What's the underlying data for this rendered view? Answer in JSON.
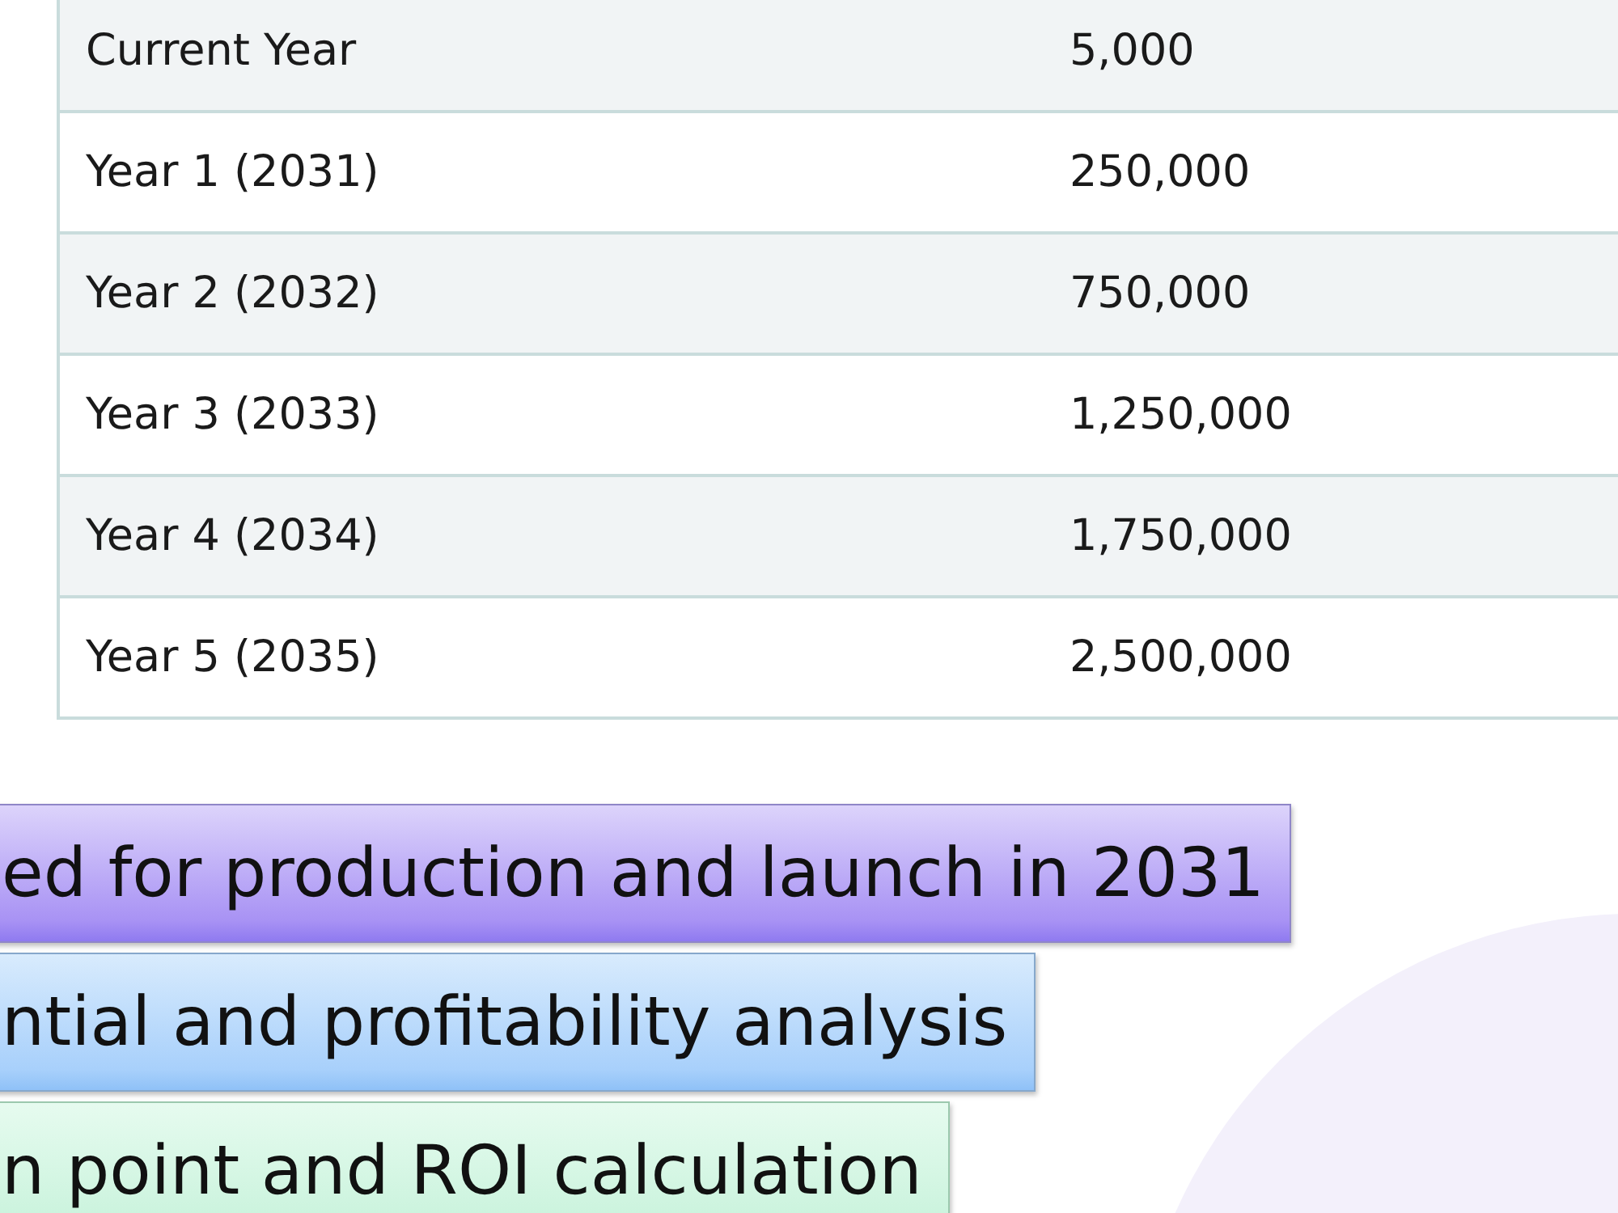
{
  "table": {
    "rows": [
      {
        "label": "Current Year",
        "value": "5,000"
      },
      {
        "label": "Year 1 (2031)",
        "value": "250,000"
      },
      {
        "label": "Year 2 (2032)",
        "value": "750,000"
      },
      {
        "label": "Year 3 (2033)",
        "value": "1,250,000"
      },
      {
        "label": "Year 4 (2034)",
        "value": "1,750,000"
      },
      {
        "label": "Year 5 (2035)",
        "value": "2,500,000"
      }
    ]
  },
  "banners": [
    {
      "text": "ed for production and launch in 2031",
      "kind": "purple"
    },
    {
      "text": "ntial and profitability analysis",
      "kind": "blue"
    },
    {
      "text": "n point and ROI calculation",
      "kind": "green"
    }
  ]
}
